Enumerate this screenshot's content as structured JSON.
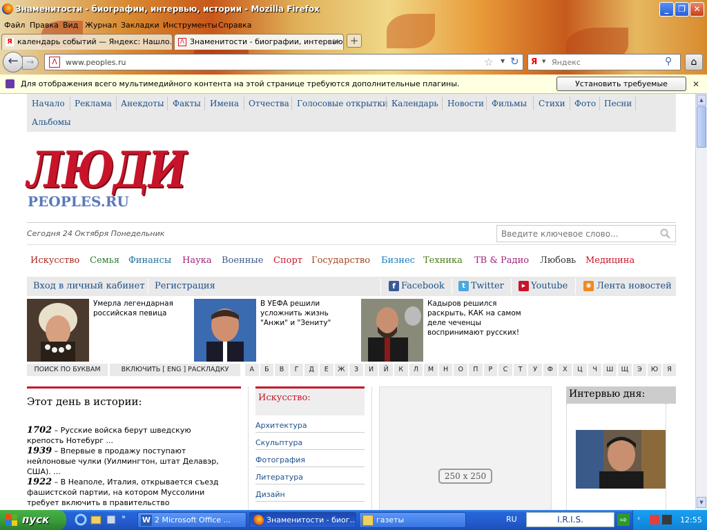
{
  "window": {
    "title": "Знаменитости - биографии, интервью, истории - Mozilla Firefox"
  },
  "menu": [
    "Файл",
    "Правка",
    "Вид",
    "Журнал",
    "Закладки",
    "Инструменты",
    "Справка"
  ],
  "tabs": [
    {
      "label": "календарь событий — Яндекс: Нашло..."
    },
    {
      "label": "Знаменитости - биографии, интервью, ..."
    }
  ],
  "url": "www.peoples.ru",
  "search_engine_placeholder": "Яндекс",
  "notification": {
    "message": "Для отображения всего мультимедийного контента на этой странице требуются дополнительные плагины.",
    "button": "Установить требуемые плагины..."
  },
  "site": {
    "topnav": [
      "Начало",
      "Реклама",
      "Анекдоты",
      "Факты",
      "Имена",
      "Отчества",
      "Голосовые открытки",
      "Календарь",
      "Новости",
      "Фильмы",
      "Стихи",
      "Фото",
      "Песни",
      "Альбомы"
    ],
    "logo": {
      "main": "ЛЮДИ",
      "sub": "PEOPLES.RU"
    },
    "date": "Сегодня 24 Октября Понедельник",
    "search_placeholder": "Введите ключевое слово...",
    "categories": [
      {
        "label": "Искусство",
        "color": "#b0281e"
      },
      {
        "label": "Семья",
        "color": "#2e7d32"
      },
      {
        "label": "Финансы",
        "color": "#1b6f9a"
      },
      {
        "label": "Наука",
        "color": "#a0207a"
      },
      {
        "label": "Военные",
        "color": "#3a5a8a"
      },
      {
        "label": "Спорт",
        "color": "#c8142a"
      },
      {
        "label": "Государство",
        "color": "#a4451a"
      },
      {
        "label": "Бизнес",
        "color": "#1a78b8"
      },
      {
        "label": "Техника",
        "color": "#4a7a1a"
      },
      {
        "label": "ТВ & Радио",
        "color": "#a0207a"
      },
      {
        "label": "Любовь",
        "color": "#333333"
      },
      {
        "label": "Медицина",
        "color": "#c8142a"
      }
    ],
    "login": "Вход в личный кабинет",
    "register": "Регистрация",
    "social": [
      "Facebook",
      "Twitter",
      "Youtube",
      "Лента новостей"
    ],
    "news": [
      {
        "text": "Умерла легендарная российская певица"
      },
      {
        "text": "В УЕФА решили усложнить жизнь \"Анжи\" и \"Зениту\""
      },
      {
        "text": "Кадыров решился раскрыть, КАК на самом деле чеченцы воспринимают русских!"
      }
    ],
    "alpha_search": "ПОИСК ПО БУКВАМ",
    "alpha_layout": "ВКЛЮЧИТЬ [ ENG ] РАСКЛАДКУ",
    "letters": [
      "А",
      "Б",
      "В",
      "Г",
      "Д",
      "Е",
      "Ж",
      "З",
      "И",
      "Й",
      "К",
      "Л",
      "М",
      "Н",
      "О",
      "П",
      "Р",
      "С",
      "Т",
      "У",
      "Ф",
      "Х",
      "Ц",
      "Ч",
      "Ш",
      "Щ",
      "Э",
      "Ю",
      "Я"
    ],
    "history": {
      "title": "Этот день в истории:",
      "items": [
        {
          "year": "1702",
          "text": " – Русские войска берут шведскую крепость Нотебург ..."
        },
        {
          "year": "1939",
          "text": " – Впервые в продажу поступают нейлоновые чулки (Уилмингтон, штат Делавэр, США). ..."
        },
        {
          "year": "1922",
          "text": " – В Неаполе, Италия, открывается съезд фашистской партии, на котором Муссолини требует включить в правительство представителей своей партии"
        }
      ]
    },
    "arts": {
      "title": "Искусство:",
      "items": [
        "Архитектура",
        "Скульптура",
        "Фотография",
        "Литература",
        "Дизайн"
      ]
    },
    "ad_label": "250 x 250",
    "interview_title": "Интервью дня:"
  },
  "taskbar": {
    "start": "пуск",
    "buttons": [
      "2 Microsoft Office ...",
      "Знаменитости - биог...",
      "газеты"
    ],
    "lang": "RU",
    "iris": "I.R.I.S.",
    "clock": "12:55"
  }
}
